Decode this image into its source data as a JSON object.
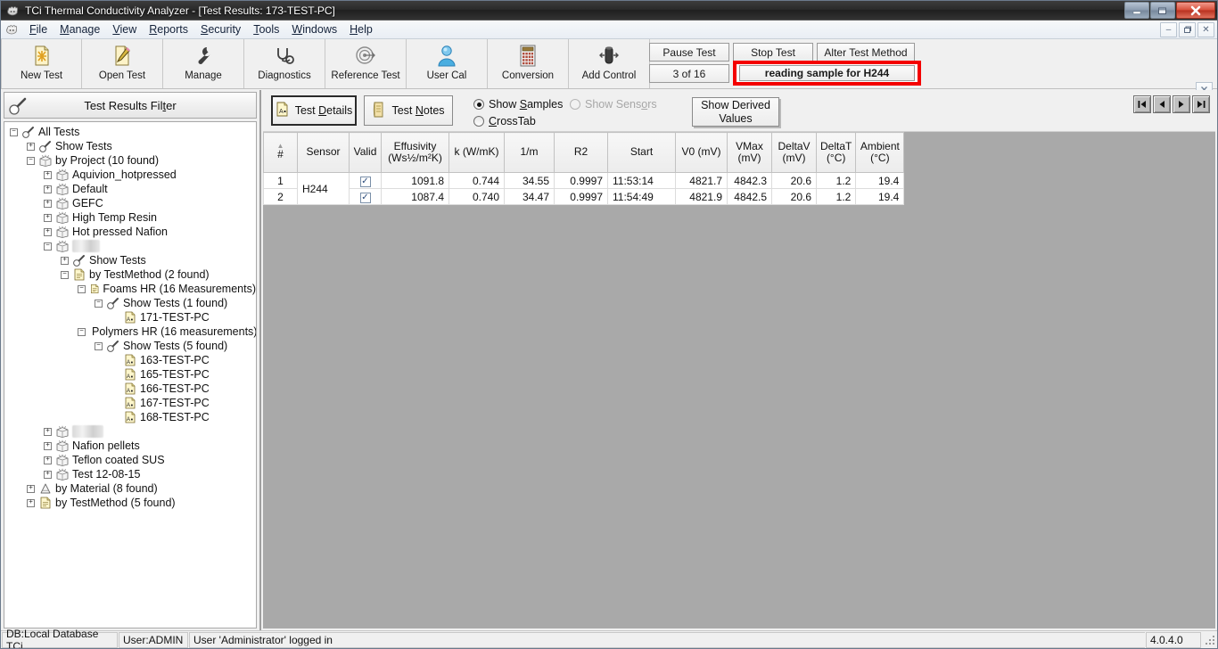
{
  "window": {
    "title": "TCi Thermal Conductivity Analyzer - [Test Results: 173-TEST-PC]",
    "minimize": "minimize-icon",
    "restore": "restore-icon",
    "close": "close-icon"
  },
  "menu": {
    "items": [
      {
        "label": "File",
        "accel": "F"
      },
      {
        "label": "Manage",
        "accel": "M"
      },
      {
        "label": "View",
        "accel": "V"
      },
      {
        "label": "Reports",
        "accel": "R"
      },
      {
        "label": "Security",
        "accel": "S"
      },
      {
        "label": "Tools",
        "accel": "T"
      },
      {
        "label": "Windows",
        "accel": "W"
      },
      {
        "label": "Help",
        "accel": "H"
      }
    ],
    "mdi": {
      "minimize": "–",
      "restore": "❐",
      "close": "✕"
    }
  },
  "toolbar": {
    "buttons": [
      {
        "label": "New Test",
        "icon": "new-document-icon"
      },
      {
        "label": "Open Test",
        "icon": "edit-document-icon"
      },
      {
        "label": "Manage",
        "icon": "wrench-icon"
      },
      {
        "label": "Diagnostics",
        "icon": "stethoscope-icon"
      },
      {
        "label": "Reference Test",
        "icon": "target-icon"
      },
      {
        "label": "User Cal",
        "icon": "user-icon"
      },
      {
        "label": "Conversion",
        "icon": "calculator-icon"
      },
      {
        "label": "Add Control",
        "icon": "control-icon"
      }
    ],
    "close_icon": "✕"
  },
  "test_control": {
    "pause_label": "Pause Test",
    "stop_label": "Stop Test",
    "alter_label": "Alter Test Method",
    "counter": "3 of 16",
    "status_message": "reading sample for H244",
    "highlight_color": "#f40000"
  },
  "filter_panel": {
    "header": "Test Results Filter",
    "header_accel": "t",
    "search_icon": "magnifier-icon",
    "tree": [
      {
        "indent": 0,
        "expander": "minus",
        "icon": "magnifier-icon",
        "label": "All Tests",
        "redacted": false
      },
      {
        "indent": 1,
        "expander": "plus",
        "icon": "magnifier-icon",
        "label": "Show Tests",
        "redacted": false
      },
      {
        "indent": 1,
        "expander": "minus",
        "icon": "box-icon",
        "label": "by Project (10 found)",
        "redacted": false
      },
      {
        "indent": 2,
        "expander": "plus",
        "icon": "box-icon",
        "label": "Aquivion_hotpressed",
        "redacted": false
      },
      {
        "indent": 2,
        "expander": "plus",
        "icon": "box-icon",
        "label": "Default",
        "redacted": false
      },
      {
        "indent": 2,
        "expander": "plus",
        "icon": "box-icon",
        "label": "GEFC",
        "redacted": false
      },
      {
        "indent": 2,
        "expander": "plus",
        "icon": "box-icon",
        "label": "High Temp Resin",
        "redacted": false
      },
      {
        "indent": 2,
        "expander": "plus",
        "icon": "box-icon",
        "label": "Hot pressed Nafion",
        "redacted": false
      },
      {
        "indent": 2,
        "expander": "minus",
        "icon": "box-icon",
        "label": "         ",
        "redacted": true
      },
      {
        "indent": 3,
        "expander": "plus",
        "icon": "magnifier-icon",
        "label": "Show Tests",
        "redacted": false
      },
      {
        "indent": 3,
        "expander": "minus",
        "icon": "method-icon",
        "label": "by TestMethod (2 found)",
        "redacted": false
      },
      {
        "indent": 4,
        "expander": "minus",
        "icon": "method-icon",
        "label": "Foams HR (16 Measurements)",
        "redacted": false
      },
      {
        "indent": 5,
        "expander": "minus",
        "icon": "magnifier-icon",
        "label": "Show Tests (1 found)",
        "redacted": false
      },
      {
        "indent": 6,
        "expander": "none",
        "icon": "test-icon",
        "label": "171-TEST-PC",
        "redacted": false
      },
      {
        "indent": 4,
        "expander": "minus",
        "icon": "method-icon",
        "label": "Polymers HR (16 measurements)",
        "redacted": false
      },
      {
        "indent": 5,
        "expander": "minus",
        "icon": "magnifier-icon",
        "label": "Show Tests (5 found)",
        "redacted": false
      },
      {
        "indent": 6,
        "expander": "none",
        "icon": "test-icon",
        "label": "163-TEST-PC",
        "redacted": false
      },
      {
        "indent": 6,
        "expander": "none",
        "icon": "test-icon",
        "label": "165-TEST-PC",
        "redacted": false
      },
      {
        "indent": 6,
        "expander": "none",
        "icon": "test-icon",
        "label": "166-TEST-PC",
        "redacted": false
      },
      {
        "indent": 6,
        "expander": "none",
        "icon": "test-icon",
        "label": "167-TEST-PC",
        "redacted": false
      },
      {
        "indent": 6,
        "expander": "none",
        "icon": "test-icon",
        "label": "168-TEST-PC",
        "redacted": false
      },
      {
        "indent": 2,
        "expander": "plus",
        "icon": "box-icon",
        "label": "          ",
        "redacted": true
      },
      {
        "indent": 2,
        "expander": "plus",
        "icon": "box-icon",
        "label": "Nafion pellets",
        "redacted": false
      },
      {
        "indent": 2,
        "expander": "plus",
        "icon": "box-icon",
        "label": "Teflon coated SUS",
        "redacted": false
      },
      {
        "indent": 2,
        "expander": "plus",
        "icon": "box-icon",
        "label": "Test 12-08-15",
        "redacted": false
      },
      {
        "indent": 1,
        "expander": "plus",
        "icon": "material-icon",
        "label": "by Material (8 found)",
        "redacted": false
      },
      {
        "indent": 1,
        "expander": "plus",
        "icon": "method-icon",
        "label": "by TestMethod (5 found)",
        "redacted": false
      }
    ]
  },
  "results_toolbar": {
    "test_details_label": "Test Details",
    "test_details_accel": "D",
    "test_notes_label": "Test Notes",
    "test_notes_accel": "N",
    "show_samples_label": "Show Samples",
    "show_samples_accel": "S",
    "crosstab_label": "CrossTab",
    "crosstab_accel": "C",
    "show_sensors_label": "Show Sensors",
    "show_sensors_accel": "o",
    "show_sensors_enabled": false,
    "selected_view": "Show Samples",
    "show_derived_line1": "Show Derived",
    "show_derived_line2": "Values",
    "nav": {
      "first": "first-record-icon",
      "previous": "previous-record-icon",
      "next": "next-record-icon",
      "last": "last-record-icon"
    }
  },
  "results_grid": {
    "columns": [
      {
        "label": "#",
        "sorted": true
      },
      {
        "label": "Sensor"
      },
      {
        "label": "Valid"
      },
      {
        "label": "Effusivity\n(Ws½/m²K)"
      },
      {
        "label": "k (W/mK)"
      },
      {
        "label": "1/m"
      },
      {
        "label": "R2"
      },
      {
        "label": "Start"
      },
      {
        "label": "V0 (mV)"
      },
      {
        "label": "VMax\n(mV)"
      },
      {
        "label": "DeltaV\n(mV)"
      },
      {
        "label": "DeltaT\n(°C)"
      },
      {
        "label": "Ambient\n(°C)"
      }
    ],
    "sensor_group": "H244",
    "rows": [
      {
        "index": "1",
        "valid": true,
        "effusivity": "1091.8",
        "k": "0.744",
        "inv_m": "34.55",
        "r2": "0.9997",
        "start": "11:53:14",
        "v0": "4821.7",
        "vmax": "4842.3",
        "deltav": "20.6",
        "deltat": "1.2",
        "ambient": "19.4"
      },
      {
        "index": "2",
        "valid": true,
        "effusivity": "1087.4",
        "k": "0.740",
        "inv_m": "34.47",
        "r2": "0.9997",
        "start": "11:54:49",
        "v0": "4821.9",
        "vmax": "4842.5",
        "deltav": "20.6",
        "deltat": "1.2",
        "ambient": "19.4"
      }
    ]
  },
  "statusbar": {
    "database": "DB:Local Database TCi",
    "user": "User:ADMIN",
    "message": "User 'Administrator' logged in",
    "version": "4.0.4.0"
  }
}
